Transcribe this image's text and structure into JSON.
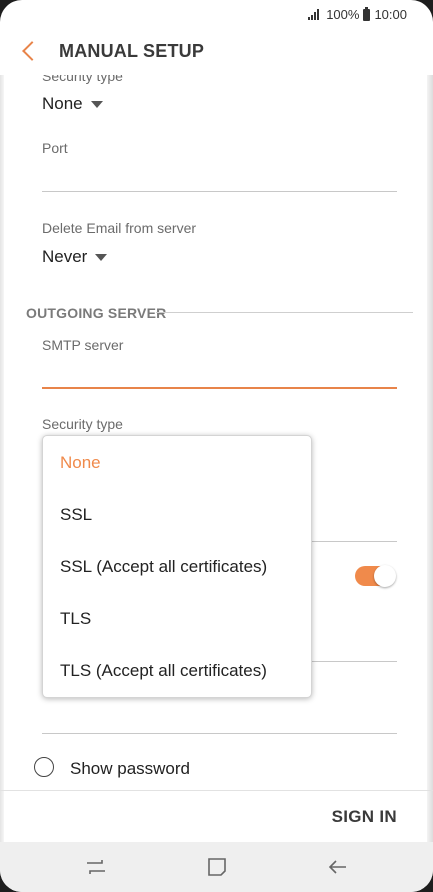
{
  "status_bar": {
    "battery": "100%",
    "time": "10:00"
  },
  "app_bar": {
    "title": "MANUAL SETUP"
  },
  "incoming": {
    "security_type_label": "Security type",
    "security_type_value": "None",
    "port_label": "Port",
    "port_value": "",
    "delete_label": "Delete Email from server",
    "delete_value": "Never"
  },
  "outgoing": {
    "section_title": "OUTGOING SERVER",
    "smtp_label": "SMTP server",
    "smtp_value": "",
    "security_type_label": "Security type"
  },
  "security_dropdown": {
    "options": [
      "None",
      "SSL",
      "SSL (Accept all certificates)",
      "TLS",
      "TLS (Accept all certificates)"
    ],
    "selected": "None"
  },
  "toggle": {
    "on": true,
    "accent": "#f08a4b"
  },
  "show_password": {
    "label": "Show password",
    "checked": false
  },
  "actions": {
    "sign_in": "SIGN IN"
  },
  "nav_bar": {
    "recent_icon": "recent-apps-icon",
    "home_icon": "home-icon",
    "back_icon": "back-arrow-icon"
  },
  "colors": {
    "accent": "#e8844a",
    "text": "#222222",
    "secondary": "#6b6b6b"
  }
}
